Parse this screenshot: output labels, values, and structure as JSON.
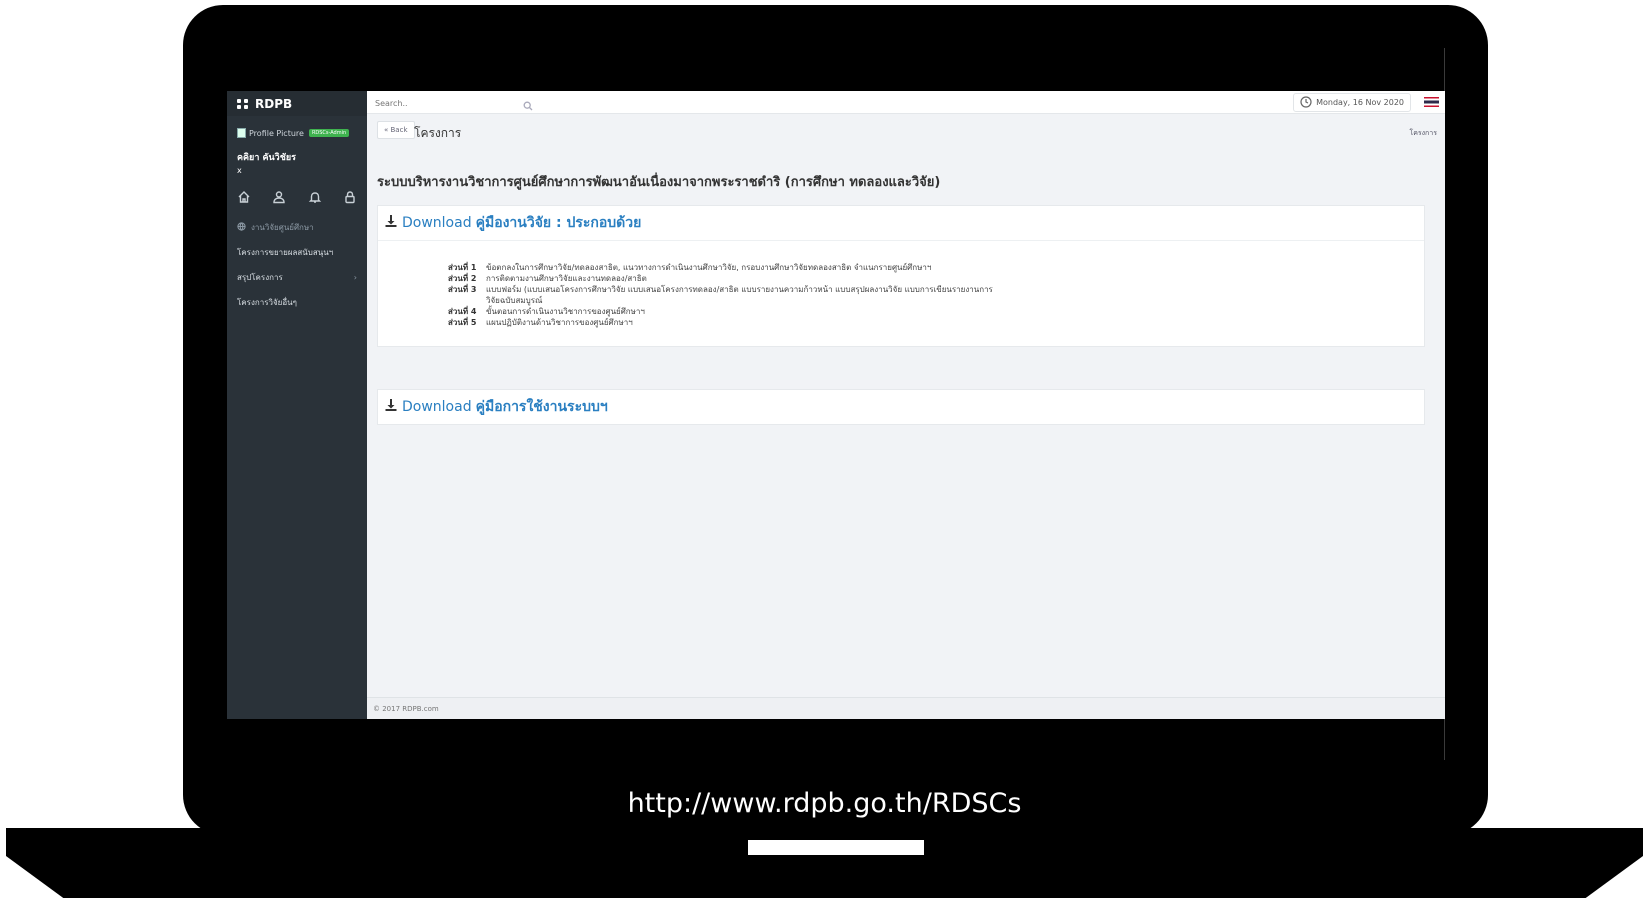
{
  "url_caption": "http://www.rdpb.go.th/RDSCs",
  "sidebar": {
    "brand": "RDPB",
    "profile_alt": "Profile Picture",
    "role_badge": "RDSCs-Admin",
    "user_name": "คคิยา คันวิชัยร",
    "user_sub": "x",
    "quick_icons": [
      "home-icon",
      "user-icon",
      "bell-icon",
      "lock-icon"
    ],
    "menu": [
      {
        "label": "งานวิจัยศูนย์ศึกษา",
        "icon": "globe-icon",
        "active": true
      },
      {
        "label": "โครงการขยายผลสนับสนุนฯ"
      },
      {
        "label": "สรุปโครงการ",
        "chevron": "›"
      },
      {
        "label": "โครงการวิจัยอื่นๆ"
      }
    ]
  },
  "topbar": {
    "search_placeholder": "Search..",
    "date": "Monday, 16 Nov 2020"
  },
  "page": {
    "back_label": "« Back",
    "title": "โครงการ",
    "breadcrumb": "โครงการ",
    "system_title": "ระบบบริหารงานวิชาการศูนย์ศึกษาการพัฒนาอันเนื่องมาจากพระราชดำริ (การศึกษา ทดลองและวิจัย)"
  },
  "panels": [
    {
      "prefix": "Download",
      "title": "คู่มืองานวิจัย : ประกอบด้วย",
      "parts": [
        {
          "label": "ส่วนที่ 1",
          "text": "ข้อตกลงในการศึกษาวิจัย/ทดลองสาธิต, แนวทางการดำเนินงานศึกษาวิจัย, กรอบงานศึกษาวิจัยทดลองสาธิต จำแนกรายศูนย์ศึกษาฯ"
        },
        {
          "label": "ส่วนที่ 2",
          "text": "การติดตามงานศึกษาวิจัยและงานทดลอง/สาธิต"
        },
        {
          "label": "ส่วนที่ 3",
          "text": "แบบฟอร์ม (แบบเสนอโครงการศึกษาวิจัย แบบเสนอโครงการทดลอง/สาธิต แบบรายงานความก้าวหน้า แบบสรุปผลงานวิจัย แบบการเขียนรายงานการวิจัยฉบับสมบูรณ์"
        },
        {
          "label": "ส่วนที่ 4",
          "text": "ขั้นตอนการดำเนินงานวิชาการของศูนย์ศึกษาฯ"
        },
        {
          "label": "ส่วนที่ 5",
          "text": "แผนปฏิบัติงานด้านวิชาการของศูนย์ศึกษาฯ"
        }
      ]
    },
    {
      "prefix": "Download",
      "title": "คู่มือการใช้งานระบบฯ"
    }
  ],
  "footer": "© 2017 RDPB.com"
}
